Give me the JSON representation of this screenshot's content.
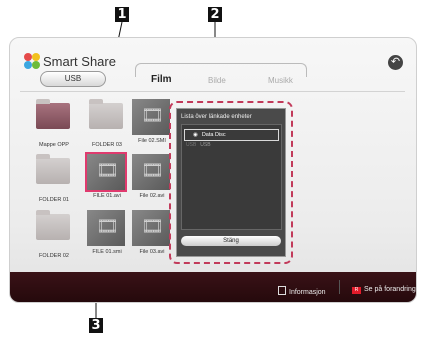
{
  "callouts": [
    "1",
    "2",
    "3"
  ],
  "header": {
    "brand": "Smart Share",
    "device_button": "USB"
  },
  "tabs": [
    {
      "label": "Film",
      "active": true
    },
    {
      "label": "Bilde",
      "active": false
    },
    {
      "label": "Musikk",
      "active": false
    }
  ],
  "back_icon": "back-arrow-icon",
  "grid": [
    {
      "label": "Mappe OPP",
      "kind": "folder-up"
    },
    {
      "label": "FOLDER 03",
      "kind": "folder"
    },
    {
      "label": "File 02.SMI",
      "kind": "film"
    },
    {
      "label": "FOLDER 01",
      "kind": "folder"
    },
    {
      "label": "FILE 01.avi",
      "kind": "film",
      "selected": true
    },
    {
      "label": "File 02.avi",
      "kind": "film"
    },
    {
      "label": "FOLDER 02",
      "kind": "folder"
    },
    {
      "label": "FILE 01.smi",
      "kind": "film"
    },
    {
      "label": "File 03.avi",
      "kind": "film"
    }
  ],
  "popup": {
    "title": "Lista över länkade enheter",
    "options": [
      {
        "label": "Data Disc",
        "selected": true
      },
      {
        "label": "USB",
        "prefix": "USB"
      }
    ],
    "close_label": "Stäng"
  },
  "footer": {
    "info_label": "Informasjon",
    "preview_key": "R",
    "preview_label": "Se på forandring"
  },
  "colors": {
    "accent": "#c23a5a",
    "footer": "#2d0e12",
    "red_key": "#e21b2a"
  }
}
